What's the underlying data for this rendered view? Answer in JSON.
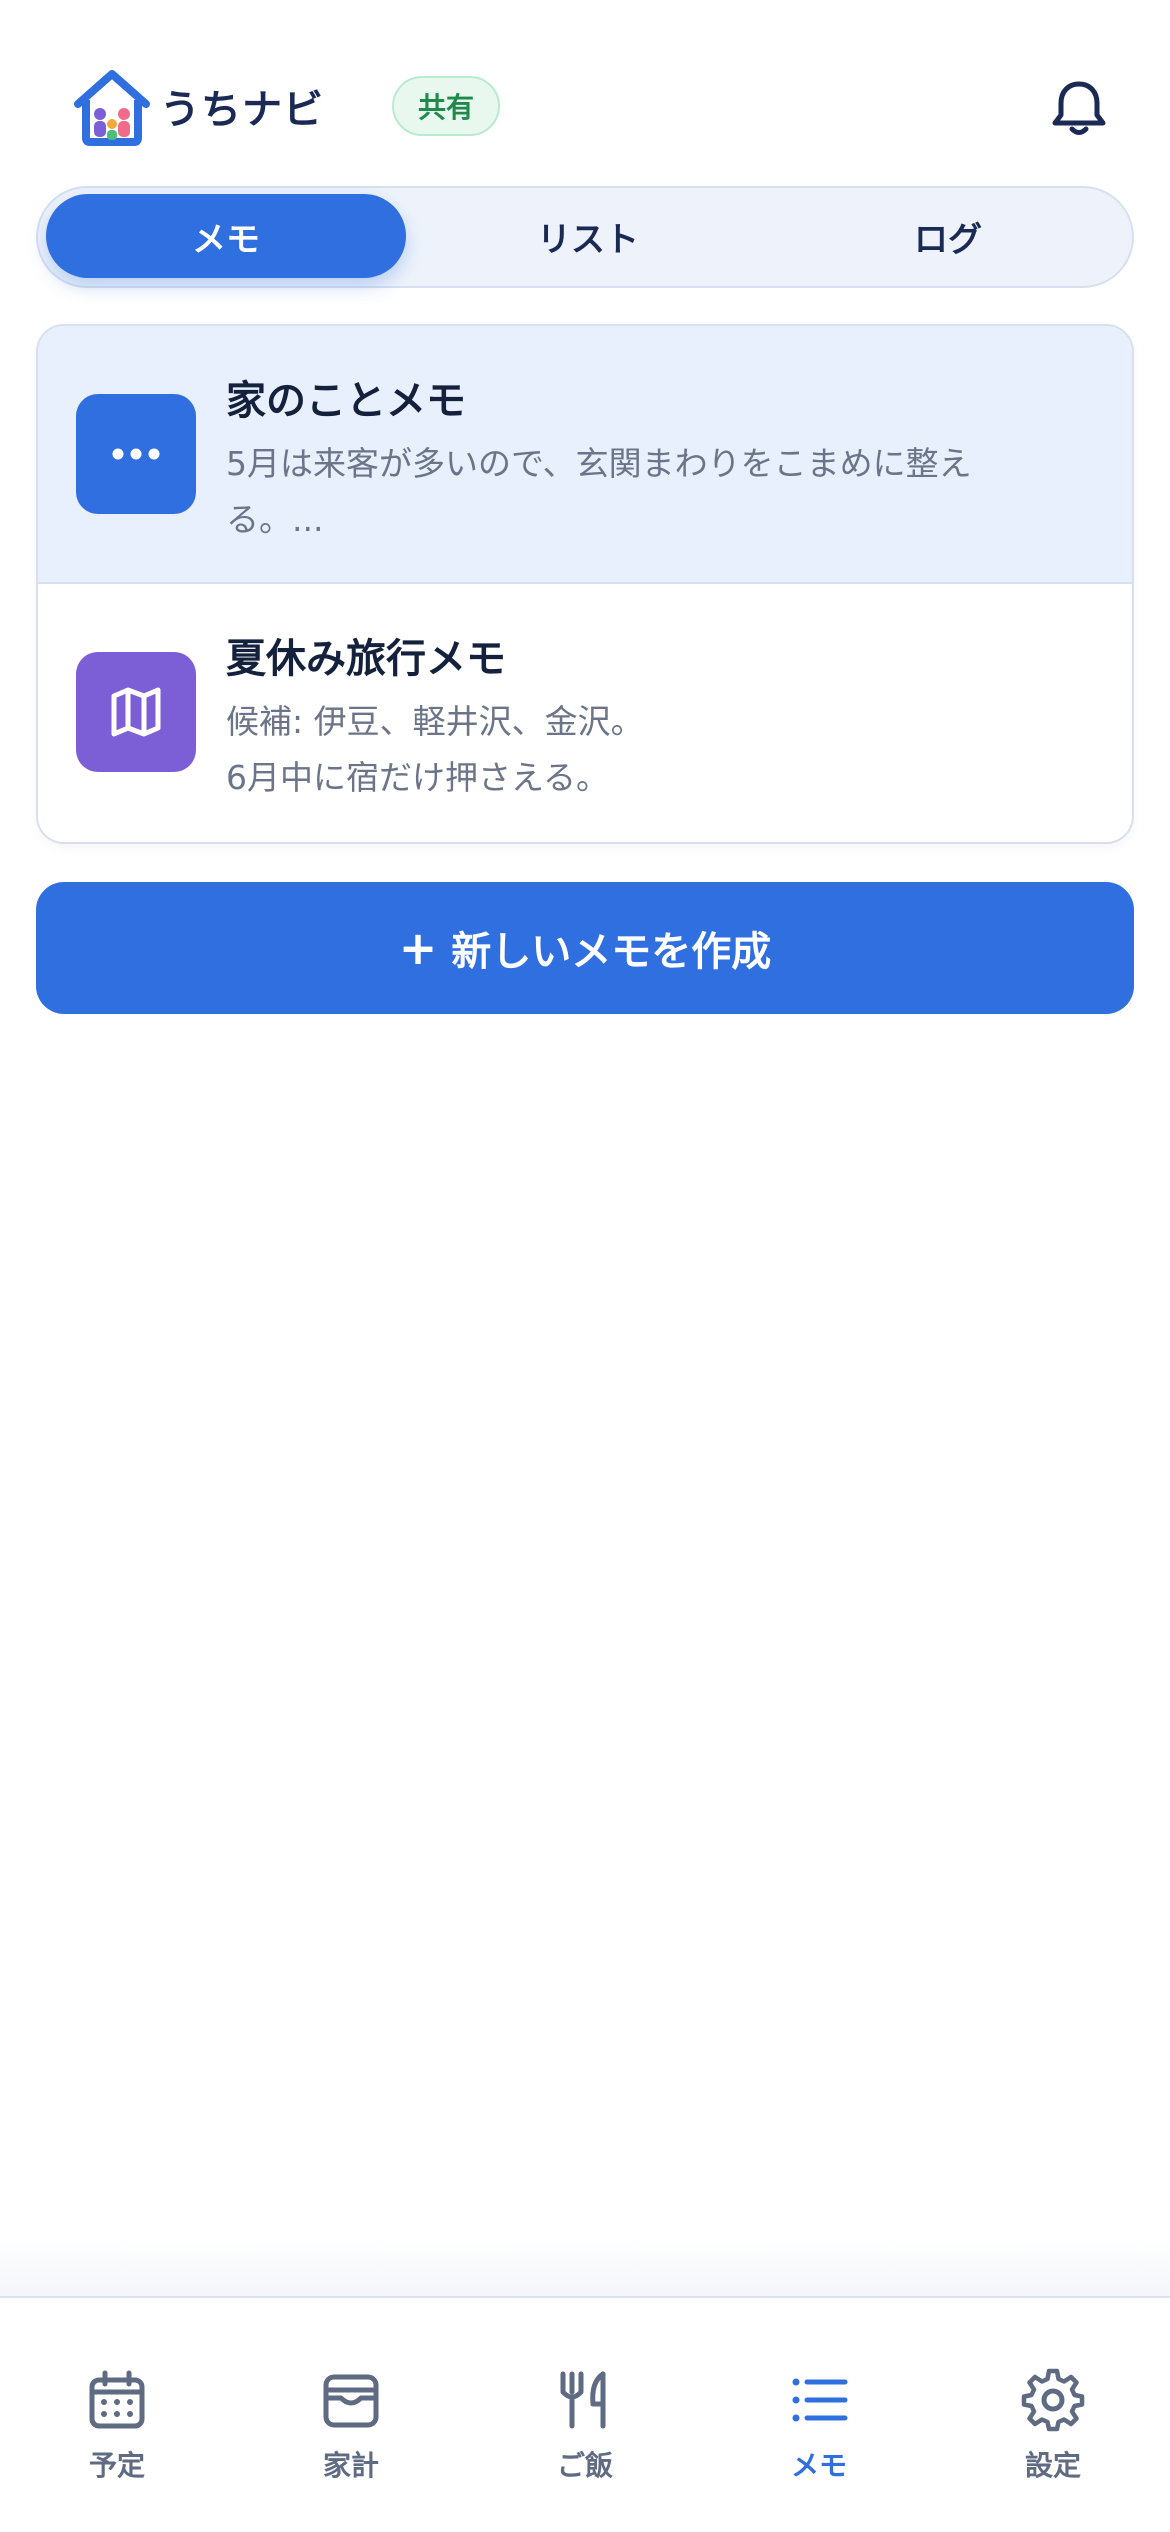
{
  "header": {
    "app_name": "うちナビ",
    "share_badge": "共有",
    "icons": {
      "logo": "house-family-logo",
      "notifications": "bell-icon"
    }
  },
  "tabs": [
    {
      "label": "メモ",
      "active": true
    },
    {
      "label": "リスト",
      "active": false
    },
    {
      "label": "ログ",
      "active": false
    }
  ],
  "memos": [
    {
      "title": "家のことメモ",
      "body_lines": [
        "5月は来客が多いので、玄関まわりをこまめに整え",
        "る。..."
      ],
      "icon": "more-dots-icon",
      "icon_color": "#2f6fe0",
      "selected": true
    },
    {
      "title": "夏休み旅行メモ",
      "body_lines": [
        "候補: 伊豆、軽井沢、金沢。",
        "6月中に宿だけ押さえる。"
      ],
      "icon": "map-icon",
      "icon_color": "#7c5fd6",
      "selected": false
    }
  ],
  "actions": {
    "new_memo_plus": "+",
    "new_memo_label": "新しいメモを作成"
  },
  "bottom_nav": [
    {
      "label": "予定",
      "icon": "calendar-icon",
      "active": false
    },
    {
      "label": "家計",
      "icon": "wallet-icon",
      "active": false
    },
    {
      "label": "ご飯",
      "icon": "utensils-icon",
      "active": false
    },
    {
      "label": "メモ",
      "icon": "list-icon",
      "active": true
    },
    {
      "label": "設定",
      "icon": "gear-icon",
      "active": false
    }
  ],
  "colors": {
    "accent": "#2f6fe0",
    "text_primary": "#14213d",
    "text_secondary": "#6b7488",
    "badge_green": "#1f8a4c"
  }
}
